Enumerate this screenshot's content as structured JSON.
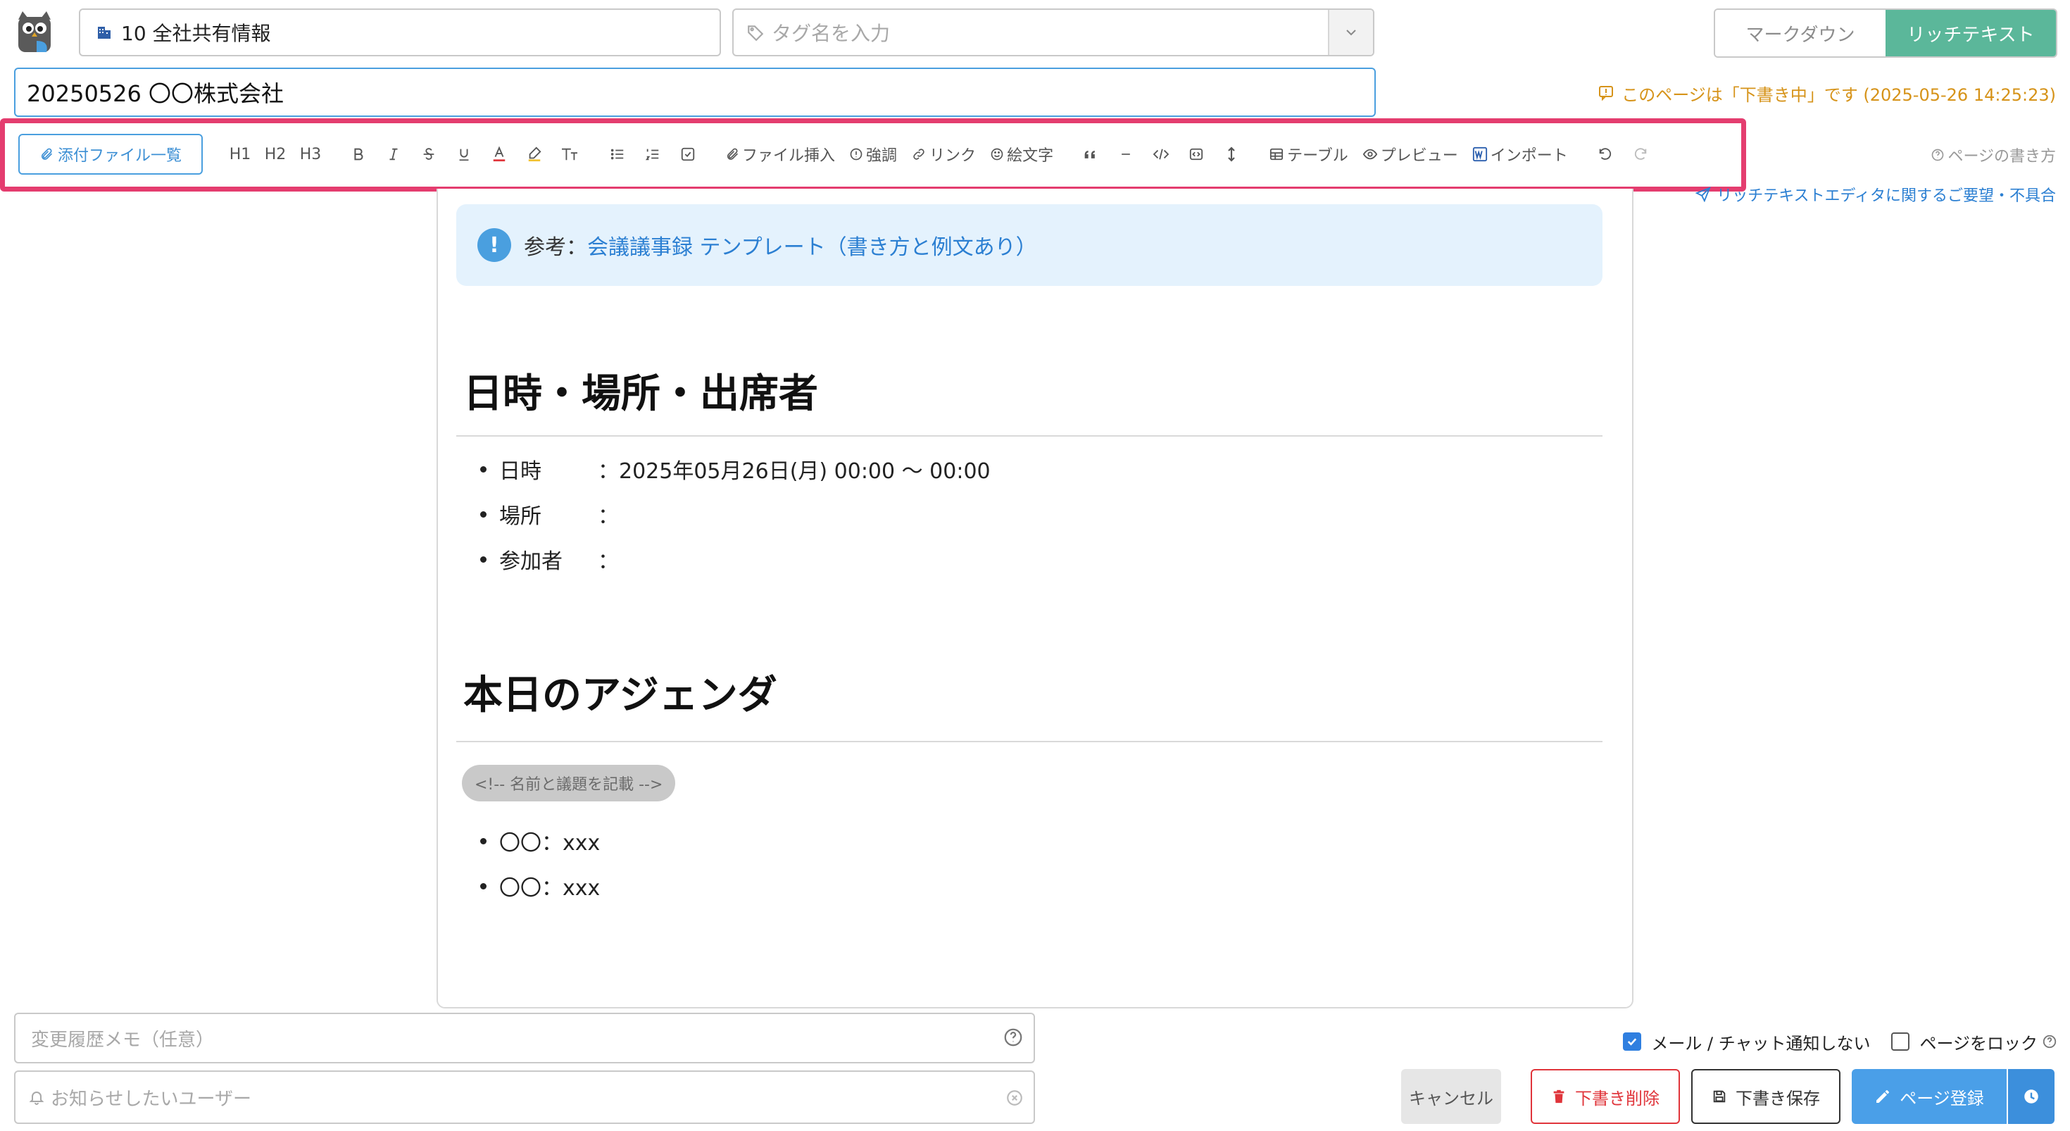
{
  "header": {
    "group_select": "10 全社共有情報",
    "tag_placeholder": "タグ名を入力",
    "mode_markdown": "マークダウン",
    "mode_richtext": "リッチテキスト"
  },
  "title_value": "20250526 〇〇株式会社",
  "draft_status": "このページは「下書き中」です (2025-05-26 14:25:23)",
  "toolbar": {
    "attachments": "添付ファイル一覧",
    "h1": "H1",
    "h2": "H2",
    "h3": "H3",
    "insert_file": "ファイル挿入",
    "emphasis": "強調",
    "link": "リンク",
    "emoji": "絵文字",
    "table": "テーブル",
    "preview": "プレビュー",
    "import": "インポート"
  },
  "help_link": "ページの書き方",
  "feedback_link": "リッチテキストエディタに関するご要望・不具合",
  "editor": {
    "callout_lead": "参考：",
    "callout_link": "会議議事録 テンプレート（書き方と例文あり）",
    "section1_heading": "日時・場所・出席者",
    "section1_items": [
      {
        "key": "日時",
        "value": "：2025年05月26日(月) 00:00 〜 00:00"
      },
      {
        "key": "場所",
        "value": "："
      },
      {
        "key": "参加者",
        "value": "："
      }
    ],
    "section2_heading": "本日のアジェンダ",
    "comment_chip": "<!-- 名前と議題を記載 -->",
    "section2_items": [
      "〇〇：xxx",
      "〇〇：xxx"
    ]
  },
  "footer": {
    "memo_placeholder": "変更履歴メモ（任意）",
    "notify_placeholder": "お知らせしたいユーザー",
    "no_notify_label": "メール / チャット通知しない",
    "no_notify_checked": true,
    "lock_label": "ページをロック",
    "lock_checked": false,
    "cancel": "キャンセル",
    "delete_draft": "下書き削除",
    "save_draft": "下書き保存",
    "register": "ページ登録"
  },
  "colors": {
    "accent_blue": "#4a9fdf",
    "richtext_green": "#5bb79a",
    "highlight_pink": "#e43d6f",
    "draft_orange": "#d69319",
    "danger_red": "#e0353b"
  }
}
